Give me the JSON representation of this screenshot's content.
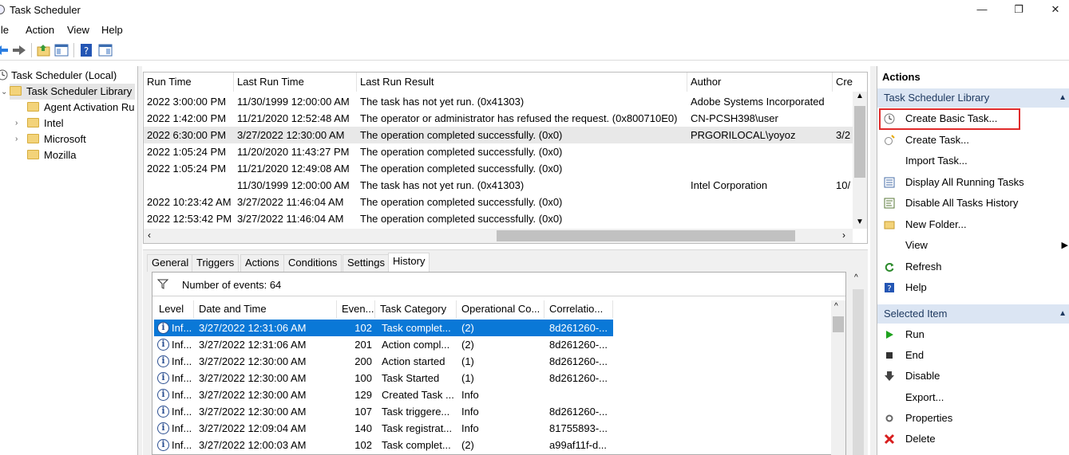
{
  "window": {
    "title": "Task Scheduler",
    "controls": [
      "—",
      "❐",
      "✕"
    ]
  },
  "menu": {
    "file": "ile",
    "action": "Action",
    "view": "View",
    "help": "Help"
  },
  "tree": {
    "root": "Task Scheduler (Local)",
    "library": "Task Scheduler Library",
    "children": [
      "Agent Activation Ru",
      "Intel",
      "Microsoft",
      "Mozilla"
    ]
  },
  "task_table": {
    "columns": [
      "Run Time",
      "Last Run Time",
      "Last Run Result",
      "Author",
      "Cre"
    ],
    "rows": [
      [
        "2022 3:00:00 PM",
        "11/30/1999 12:00:00 AM",
        "The task has not yet run. (0x41303)",
        "Adobe Systems Incorporated",
        ""
      ],
      [
        "2022 1:42:00 PM",
        "11/21/2020 12:52:48 AM",
        "The operator or administrator has refused the request. (0x800710E0)",
        "CN-PCSH398\\user",
        ""
      ],
      [
        "2022 6:30:00 PM",
        "3/27/2022 12:30:00 AM",
        "The operation completed successfully. (0x0)",
        "PRGORILOCAL\\yoyoz",
        "3/2"
      ],
      [
        "2022 1:05:24 PM",
        "11/20/2020 11:43:27 PM",
        "The operation completed successfully. (0x0)",
        "",
        ""
      ],
      [
        "2022 1:05:24 PM",
        "11/21/2020 12:49:08 AM",
        "The operation completed successfully. (0x0)",
        "",
        ""
      ],
      [
        "",
        "11/30/1999 12:00:00 AM",
        "The task has not yet run. (0x41303)",
        "Intel Corporation",
        "10/"
      ],
      [
        "2022 10:23:42 AM",
        "3/27/2022 11:46:04 AM",
        "The operation completed successfully. (0x0)",
        "",
        ""
      ],
      [
        "2022 12:53:42 PM",
        "3/27/2022 11:46:04 AM",
        "The operation completed successfully. (0x0)",
        "",
        ""
      ]
    ],
    "selected_row": 2
  },
  "tabs": [
    "General",
    "Triggers",
    "Actions",
    "Conditions",
    "Settings",
    "History"
  ],
  "active_tab": "History",
  "history": {
    "events_label": "Number of events: 64",
    "columns": [
      "Level",
      "Date and Time",
      "Even...",
      "Task Category",
      "Operational Co...",
      "Correlatio..."
    ],
    "rows": [
      [
        "Inf...",
        "3/27/2022 12:31:06 AM",
        "102",
        "Task complet...",
        "(2)",
        "8d261260-..."
      ],
      [
        "Inf...",
        "3/27/2022 12:31:06 AM",
        "201",
        "Action compl...",
        "(2)",
        "8d261260-..."
      ],
      [
        "Inf...",
        "3/27/2022 12:30:00 AM",
        "200",
        "Action started",
        "(1)",
        "8d261260-..."
      ],
      [
        "Inf...",
        "3/27/2022 12:30:00 AM",
        "100",
        "Task Started",
        "(1)",
        "8d261260-..."
      ],
      [
        "Inf...",
        "3/27/2022 12:30:00 AM",
        "129",
        "Created Task ...",
        "Info",
        ""
      ],
      [
        "Inf...",
        "3/27/2022 12:30:00 AM",
        "107",
        "Task triggere...",
        "Info",
        "8d261260-..."
      ],
      [
        "Inf...",
        "3/27/2022 12:09:04 AM",
        "140",
        "Task registrat...",
        "Info",
        "81755893-..."
      ],
      [
        "Inf...",
        "3/27/2022 12:00:03 AM",
        "102",
        "Task complet...",
        "(2)",
        "a99af11f-d..."
      ]
    ],
    "selected_row": 0
  },
  "actions": {
    "header": "Actions",
    "section1": "Task Scheduler Library",
    "items1": [
      {
        "label": "Create Basic Task...",
        "icon": "clock-wizard-icon"
      },
      {
        "label": "Create Task...",
        "icon": "create-task-icon"
      },
      {
        "label": "Import Task...",
        "icon": ""
      },
      {
        "label": "Display All Running Tasks",
        "icon": "list-icon"
      },
      {
        "label": "Disable All Tasks History",
        "icon": "history-icon"
      },
      {
        "label": "New Folder...",
        "icon": "folder-icon"
      },
      {
        "label": "View",
        "icon": ""
      },
      {
        "label": "Refresh",
        "icon": "refresh-icon"
      },
      {
        "label": "Help",
        "icon": "help-icon"
      }
    ],
    "section2": "Selected Item",
    "items2": [
      {
        "label": "Run",
        "icon": "run-icon"
      },
      {
        "label": "End",
        "icon": "end-icon"
      },
      {
        "label": "Disable",
        "icon": "disable-icon"
      },
      {
        "label": "Export...",
        "icon": ""
      },
      {
        "label": "Properties",
        "icon": "properties-icon"
      },
      {
        "label": "Delete",
        "icon": "delete-icon"
      }
    ]
  },
  "colors": {
    "selection_blue": "#0a78d7",
    "section_header": "#dbe5f3",
    "highlight_red": "#e02b2b"
  }
}
